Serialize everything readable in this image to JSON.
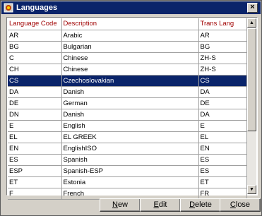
{
  "window": {
    "title": "Languages",
    "close_glyph": "×",
    "app_icon": "opera-app-icon"
  },
  "grid": {
    "columns": [
      "Language Code",
      "Description",
      "Trans Lang"
    ],
    "selected_index": 4,
    "rows": [
      [
        "AR",
        "Arabic",
        "AR"
      ],
      [
        "BG",
        "Bulgarian",
        "BG"
      ],
      [
        "C",
        "Chinese",
        "ZH-S"
      ],
      [
        "CH",
        "Chinese",
        "ZH-S"
      ],
      [
        "CS",
        "Czechoslovakian",
        "CS"
      ],
      [
        "DA",
        "Danish",
        "DA"
      ],
      [
        "DE",
        "German",
        "DE"
      ],
      [
        "DN",
        "Danish",
        "DA"
      ],
      [
        "E",
        "English",
        "E"
      ],
      [
        "EL",
        "EL GREEK",
        "EL"
      ],
      [
        "EN",
        "EnglishISO",
        "EN"
      ],
      [
        "ES",
        "Spanish",
        "ES"
      ],
      [
        "ESP",
        "Spanish-ESP",
        "ES"
      ],
      [
        "ET",
        "Estonia",
        "ET"
      ],
      [
        "F",
        "French",
        "FR"
      ]
    ]
  },
  "scrollbar": {
    "up_glyph": "▲",
    "down_glyph": "▼"
  },
  "buttons": [
    {
      "label": "New",
      "access_key_index": 0
    },
    {
      "label": "Edit",
      "access_key_index": 0
    },
    {
      "label": "Delete",
      "access_key_index": 0
    },
    {
      "label": "Close",
      "access_key_index": 0
    }
  ],
  "colors": {
    "titlebar": "#0a246a",
    "header_text": "#a00000",
    "selection": "#0a246a"
  }
}
